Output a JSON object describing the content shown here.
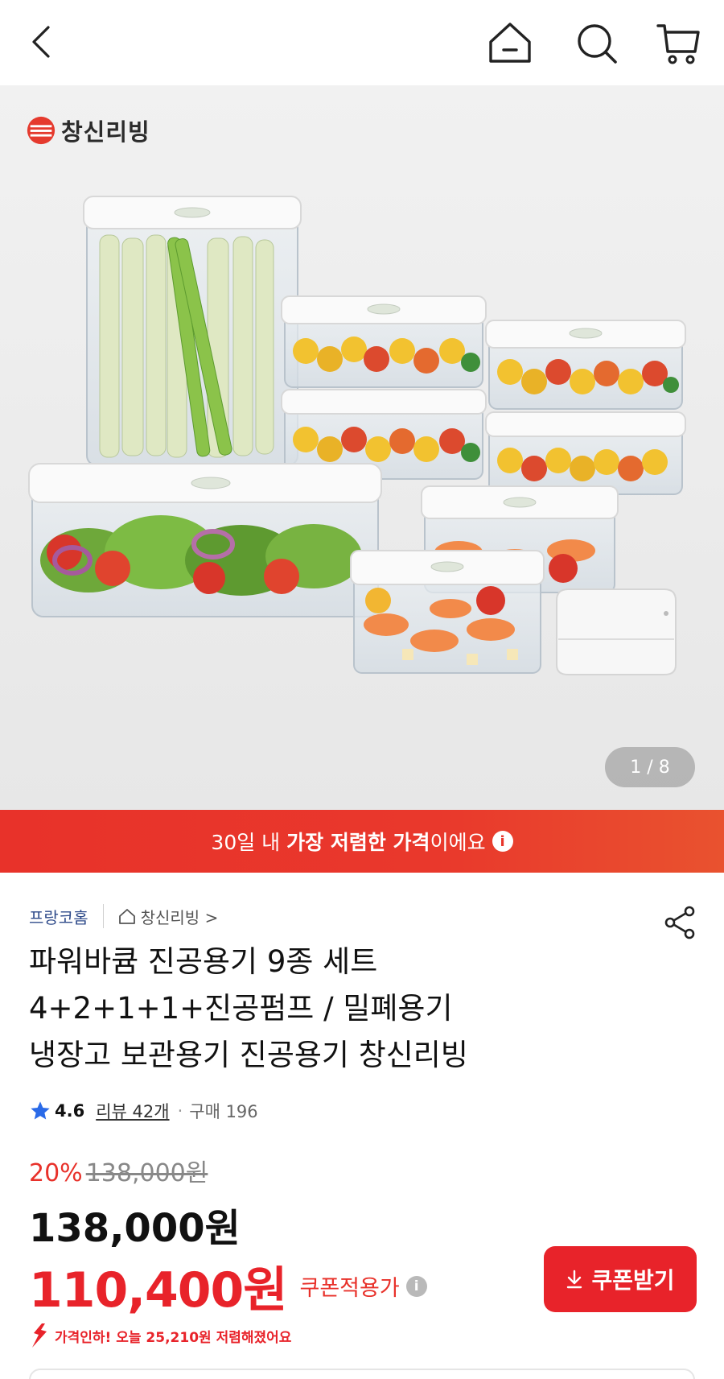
{
  "header": {
    "back_icon": "chevron-left-icon",
    "home_icon": "home-icon",
    "search_icon": "search-icon",
    "cart_icon": "cart-icon"
  },
  "hero": {
    "brand_logo_text": "창신리빙",
    "pager": "1 / 8"
  },
  "banner": {
    "text_before": "30일 내 ",
    "text_bold": "가장 저렴한 가격",
    "text_after": "이에요",
    "info_icon": "i",
    "color": "#e8322a"
  },
  "seller": {
    "shop_name": "프랑코홈",
    "brand_name": "창신리빙 >",
    "share_icon": "share-icon"
  },
  "product": {
    "title_lines": [
      "파워바큠 진공용기 9종 세트",
      "4+2+1+1+진공펌프 / 밀폐용기",
      "냉장고 보관용기 진공용기 창신리빙"
    ],
    "rating": "4.6",
    "reviews": "리뷰 42개",
    "purchases": "구매 196"
  },
  "price": {
    "discount_rate": "20%",
    "original_price": "138,000원",
    "sale_price": "138,000원",
    "coupon_price": "110,400원",
    "coupon_label": "쿠폰적용가",
    "coupon_button": "쿠폰받기",
    "price_drop_text": "가격인하! 오늘 25,210원 저렴해졌어요",
    "accent_color": "#e8232a"
  }
}
